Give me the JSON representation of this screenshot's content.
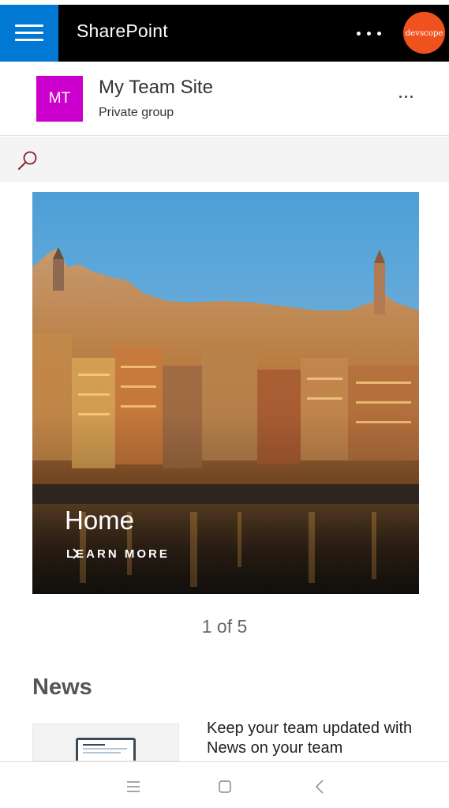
{
  "app": {
    "title": "SharePoint",
    "org_avatar_text": "devscope",
    "org_avatar_color": "#f0521f",
    "nav_color": "#0078d4"
  },
  "site": {
    "logo_text": "MT",
    "logo_color": "#cc00cc",
    "name": "My Team Site",
    "type": "Private group"
  },
  "search": {
    "icon": "search-icon"
  },
  "hero": {
    "title": "Home",
    "link_label": "LEARN MORE",
    "pager": "1 of 5"
  },
  "news": {
    "heading": "News",
    "items": [
      {
        "title": "Keep your team updated with News on your team"
      }
    ]
  },
  "system_nav": {
    "buttons": [
      "menu-icon",
      "home-icon",
      "back-icon"
    ]
  }
}
